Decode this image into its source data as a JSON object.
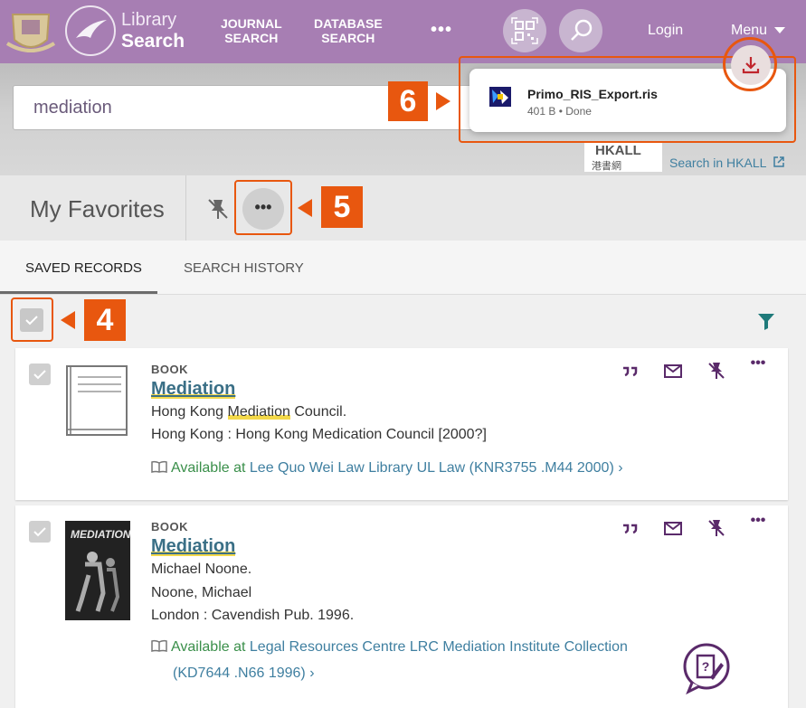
{
  "header": {
    "brand_line1": "Library",
    "brand_line2": "Search",
    "nav": [
      {
        "label_line1": "JOURNAL",
        "label_line2": "SEARCH"
      },
      {
        "label_line1": "DATABASE",
        "label_line2": "SEARCH"
      }
    ],
    "more_label": "•••",
    "login_label": "Login",
    "menu_label": "Menu"
  },
  "search": {
    "query": "mediation",
    "hkall_text": "HKALL",
    "hkall_chinese": "港書網",
    "hkall_link": "Search in HKALL"
  },
  "favorites": {
    "title": "My Favorites",
    "more_label": "•••"
  },
  "tabs": [
    {
      "label": "SAVED RECORDS",
      "active": true
    },
    {
      "label": "SEARCH HISTORY",
      "active": false
    }
  ],
  "callouts": {
    "step4": "4",
    "step5": "5",
    "step6": "6"
  },
  "records": [
    {
      "type": "BOOK",
      "title": "Mediation",
      "author_pre": "Hong Kong ",
      "author_hl": "Mediation",
      "author_post": " Council.",
      "publication": "Hong Kong : Hong Kong Medication Council [2000?]",
      "availability_prefix": "Available at",
      "library": "Lee Quo Wei Law Library  UL Law (KNR3755 .M44 2000)"
    },
    {
      "type": "BOOK",
      "title": "Mediation",
      "author": "Michael Noone.",
      "author_alt": "Noone, Michael",
      "publication": "London : Cavendish Pub. 1996.",
      "availability_prefix": "Available at",
      "library": "Legal Resources Centre  LRC Mediation Institute Collection",
      "library_line2": "(KD7644 .N66 1996)",
      "cover_text": "MEDIATION"
    }
  ],
  "download": {
    "filename": "Primo_RIS_Export.ris",
    "meta": "401 B • Done"
  },
  "colors": {
    "header": "#a77eb3",
    "accent": "#e8570f",
    "title_link": "#3a6f86",
    "available": "#3a8f4a",
    "icon_purple": "#5a2a6a"
  }
}
